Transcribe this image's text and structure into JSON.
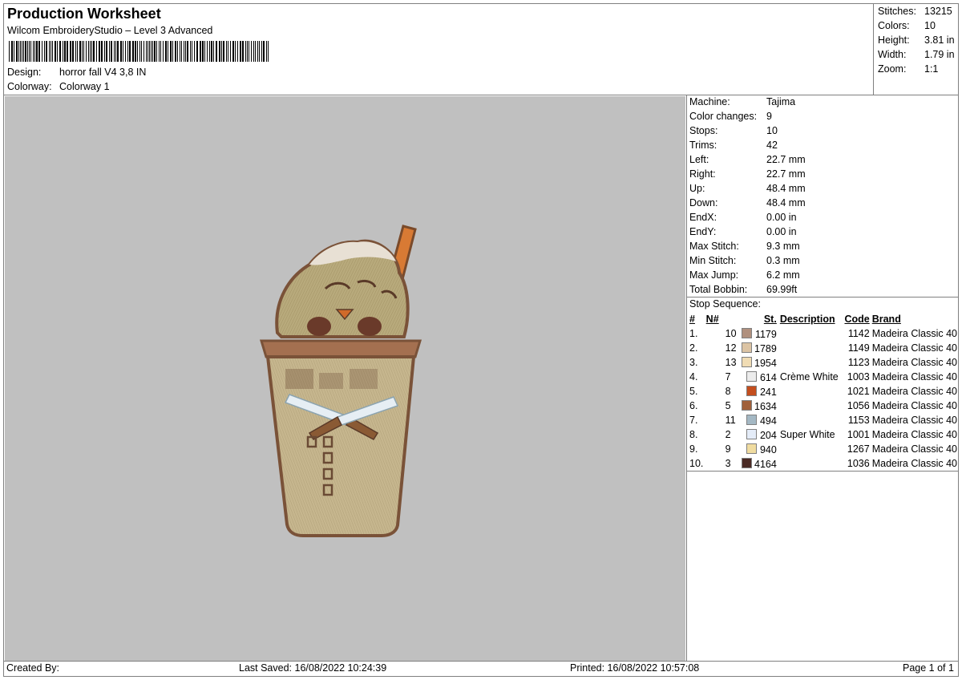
{
  "header": {
    "title": "Production Worksheet",
    "subtitle": "Wilcom EmbroideryStudio – Level 3 Advanced",
    "design_label": "Design:",
    "design_value": "horror fall V4 3,8 IN",
    "colorway_label": "Colorway:",
    "colorway_value": "Colorway 1"
  },
  "stats": [
    {
      "label": "Stitches:",
      "value": "13215"
    },
    {
      "label": "Colors:",
      "value": "10"
    },
    {
      "label": "Height:",
      "value": "3.81 in"
    },
    {
      "label": "Width:",
      "value": "1.79 in"
    },
    {
      "label": "Zoom:",
      "value": "1:1"
    }
  ],
  "specs": [
    {
      "label": "Machine:",
      "value": "Tajima"
    },
    {
      "label": "Color changes:",
      "value": "9"
    },
    {
      "label": "Stops:",
      "value": "10"
    },
    {
      "label": "Trims:",
      "value": "42"
    },
    {
      "label": "Left:",
      "value": "22.7 mm"
    },
    {
      "label": "Right:",
      "value": "22.7 mm"
    },
    {
      "label": "Up:",
      "value": "48.4 mm"
    },
    {
      "label": "Down:",
      "value": "48.4 mm"
    },
    {
      "label": "EndX:",
      "value": "0.00 in"
    },
    {
      "label": "EndY:",
      "value": "0.00 in"
    },
    {
      "label": "Max Stitch:",
      "value": "9.3 mm"
    },
    {
      "label": "Min Stitch:",
      "value": "0.3 mm"
    },
    {
      "label": "Max Jump:",
      "value": "6.2 mm"
    },
    {
      "label": "Total Bobbin:",
      "value": "69.99ft"
    }
  ],
  "sequence": {
    "title": "Stop Sequence:",
    "headers": [
      "#",
      "N#",
      "St.",
      "Description",
      "Code",
      "Brand"
    ],
    "rows": [
      {
        "idx": "1.",
        "n": "10",
        "color": "#b0907e",
        "st": "1179",
        "desc": "",
        "code": "1142",
        "brand": "Madeira Classic 40"
      },
      {
        "idx": "2.",
        "n": "12",
        "color": "#dcc4a4",
        "st": "1789",
        "desc": "",
        "code": "1149",
        "brand": "Madeira Classic 40"
      },
      {
        "idx": "3.",
        "n": "13",
        "color": "#f0dcb4",
        "st": "1954",
        "desc": "",
        "code": "1123",
        "brand": "Madeira Classic 40"
      },
      {
        "idx": "4.",
        "n": "7",
        "color": "#ececec",
        "st": "614",
        "desc": "Crème White",
        "code": "1003",
        "brand": "Madeira Classic 40"
      },
      {
        "idx": "5.",
        "n": "8",
        "color": "#c44e1e",
        "st": "241",
        "desc": "",
        "code": "1021",
        "brand": "Madeira Classic 40"
      },
      {
        "idx": "6.",
        "n": "5",
        "color": "#a0603a",
        "st": "1634",
        "desc": "",
        "code": "1056",
        "brand": "Madeira Classic 40"
      },
      {
        "idx": "7.",
        "n": "11",
        "color": "#a4b8c4",
        "st": "494",
        "desc": "",
        "code": "1153",
        "brand": "Madeira Classic 40"
      },
      {
        "idx": "8.",
        "n": "2",
        "color": "#e4ecf8",
        "st": "204",
        "desc": "Super White",
        "code": "1001",
        "brand": "Madeira Classic 40"
      },
      {
        "idx": "9.",
        "n": "9",
        "color": "#f0dca0",
        "st": "940",
        "desc": "",
        "code": "1267",
        "brand": "Madeira Classic 40"
      },
      {
        "idx": "10.",
        "n": "3",
        "color": "#4a2a24",
        "st": "4164",
        "desc": "",
        "code": "1036",
        "brand": "Madeira Classic 40"
      }
    ]
  },
  "footer": {
    "created_by": "Created By:",
    "last_saved": "Last Saved: 16/08/2022 10:24:39",
    "printed": "Printed: 16/08/2022 10:57:08",
    "page": "Page 1 of 1"
  },
  "colors": {
    "canvas_bg": "#c0c0c0",
    "outline": "#7a5238",
    "cup_fill": "#c8b890",
    "cream_fill": "#b4a678",
    "straw": "#d06a2a"
  }
}
